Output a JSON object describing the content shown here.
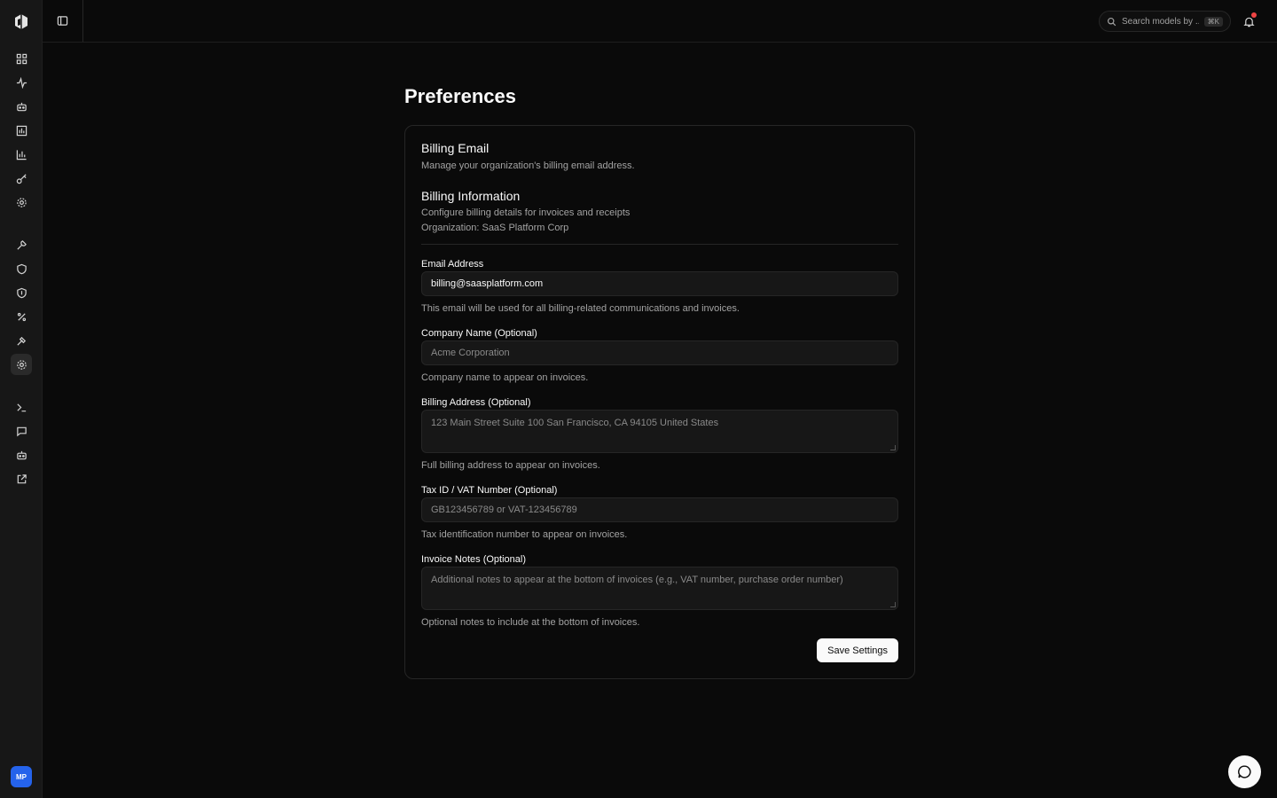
{
  "sidebar": {
    "avatar_initials": "MP",
    "items": [
      {
        "icon": "dashboard-icon"
      },
      {
        "icon": "activity-icon"
      },
      {
        "icon": "bot-icon"
      },
      {
        "icon": "bar-chart-icon"
      },
      {
        "icon": "analytics-icon"
      },
      {
        "icon": "key-icon"
      },
      {
        "icon": "settings-icon"
      },
      {
        "icon": "wrench-icon"
      },
      {
        "icon": "shield-icon"
      },
      {
        "icon": "shield-check-icon"
      },
      {
        "icon": "percent-icon"
      },
      {
        "icon": "hammer-icon"
      },
      {
        "icon": "gear-icon",
        "active": true
      },
      {
        "icon": "terminal-icon"
      },
      {
        "icon": "chat-icon"
      },
      {
        "icon": "robot-icon"
      },
      {
        "icon": "external-link-icon"
      }
    ]
  },
  "topbar": {
    "search_placeholder": "Search models by ...",
    "search_shortcut": "⌘K",
    "has_notification": true
  },
  "page": {
    "title": "Preferences"
  },
  "card": {
    "billing_email_title": "Billing Email",
    "billing_email_desc": "Manage your organization's billing email address.",
    "billing_info_title": "Billing Information",
    "billing_info_desc": "Configure billing details for invoices and receipts",
    "organization": "Organization: SaaS Platform Corp",
    "fields": {
      "email": {
        "label": "Email Address",
        "value": "billing@saasplatform.com",
        "hint": "This email will be used for all billing-related communications and invoices."
      },
      "company": {
        "label": "Company Name (Optional)",
        "placeholder": "Acme Corporation",
        "hint": "Company name to appear on invoices."
      },
      "address": {
        "label": "Billing Address (Optional)",
        "placeholder": "123 Main Street Suite 100 San Francisco, CA 94105 United States",
        "hint": "Full billing address to appear on invoices."
      },
      "tax": {
        "label": "Tax ID / VAT Number (Optional)",
        "placeholder": "GB123456789 or VAT-123456789",
        "hint": "Tax identification number to appear on invoices."
      },
      "notes": {
        "label": "Invoice Notes (Optional)",
        "placeholder": "Additional notes to appear at the bottom of invoices (e.g., VAT number, purchase order number)",
        "hint": "Optional notes to include at the bottom of invoices."
      }
    },
    "save_label": "Save Settings"
  },
  "colors": {
    "background": "#0a0a0a",
    "sidebar": "#171717",
    "avatar": "#2563eb",
    "notification_dot": "#ef4444"
  }
}
